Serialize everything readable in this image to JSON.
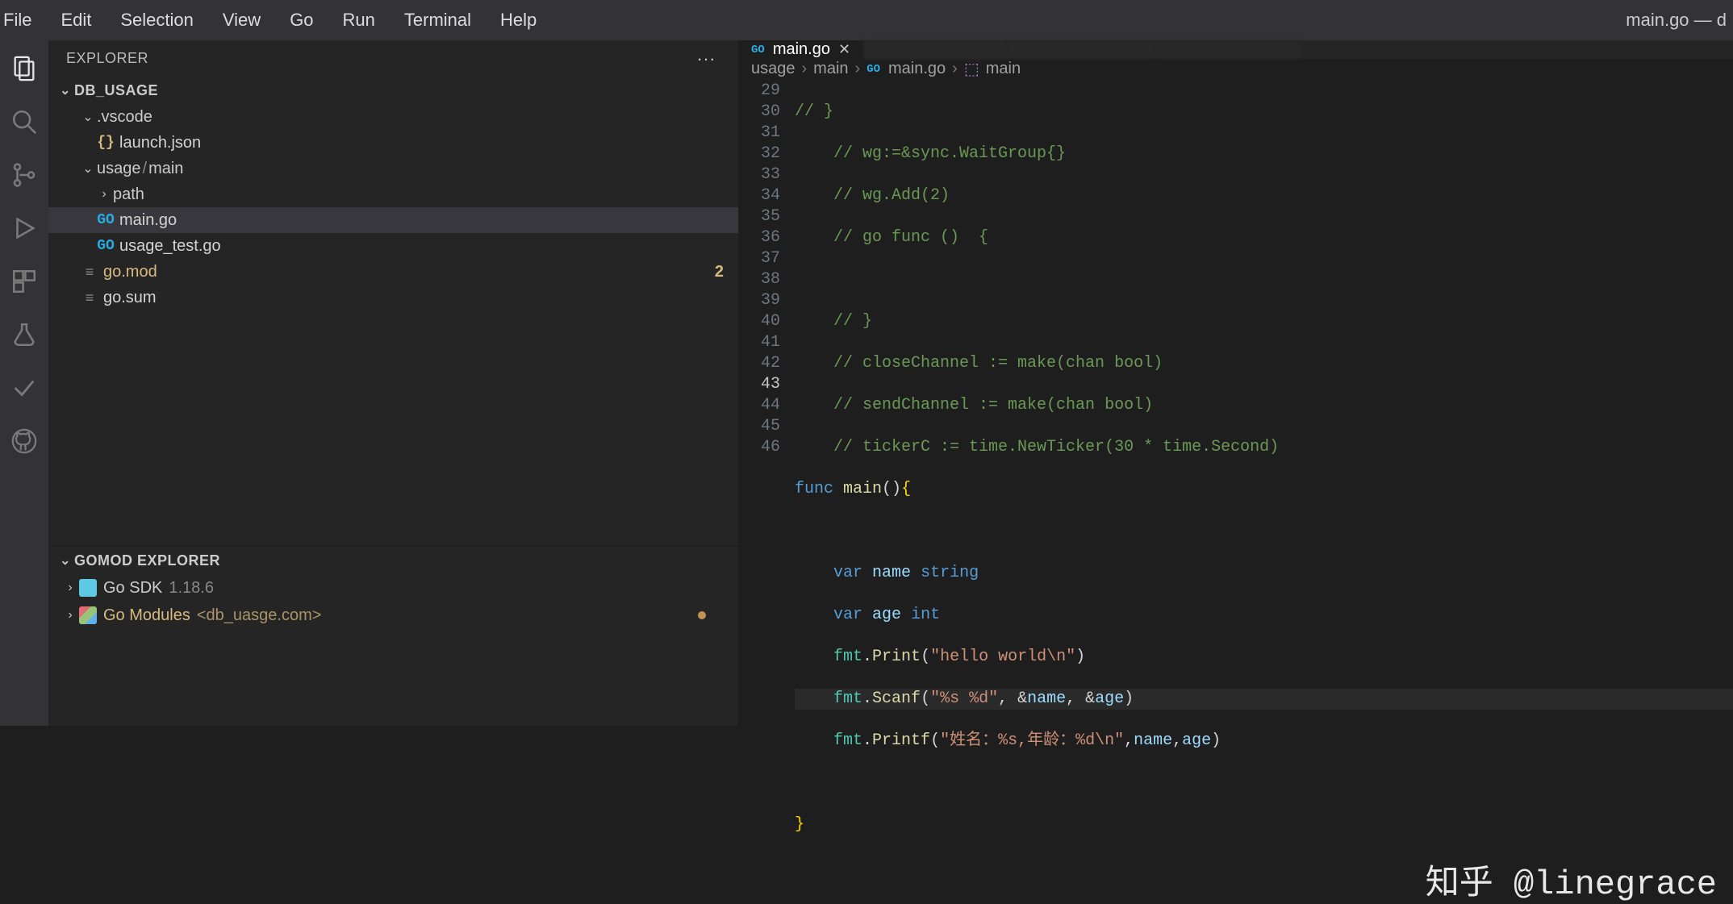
{
  "window": {
    "title": "main.go — d"
  },
  "menu": {
    "items": [
      "File",
      "Edit",
      "Selection",
      "View",
      "Go",
      "Run",
      "Terminal",
      "Help"
    ]
  },
  "sidebar": {
    "title": "EXPLORER",
    "actions_glyph": "···",
    "project_name": "DB_USAGE",
    "tree": {
      "vscode_folder": ".vscode",
      "launch_json": "launch.json",
      "usage_folder": "usage",
      "main_folder": "main",
      "path_folder": "path",
      "main_go": "main.go",
      "usage_test_go": "usage_test.go",
      "go_mod": "go.mod",
      "go_mod_badge": "2",
      "go_sum": "go.sum"
    },
    "gomod_title": "GOMOD EXPLORER",
    "gosdk_label": "Go SDK",
    "gosdk_ver": "1.18.6",
    "gomodules_label": "Go Modules",
    "gomodules_extra": "<db_uasge.com>"
  },
  "tabs": {
    "active": "main.go"
  },
  "breadcrumb": {
    "p0": "usage",
    "p1": "main",
    "p2": "main.go",
    "p3": "main"
  },
  "code": {
    "lines_start": 29,
    "l29": "// }",
    "l30": "    // wg:=&sync.WaitGroup{}",
    "l31": "    // wg.Add(2)",
    "l32": "    // go func ()  {",
    "l33": "",
    "l34": "    // }",
    "l35": "    // closeChannel := make(chan bool)",
    "l36": "    // sendChannel := make(chan bool)",
    "l37": "    // tickerC := time.NewTicker(30 * time.Second)",
    "l38_func": "func",
    "l38_main": "main",
    "l38_paren": "()",
    "l38_brace": "{",
    "l40_var": "var",
    "l40_name": "name",
    "l40_type": "string",
    "l41_var": "var",
    "l41_name": "age",
    "l41_type": "int",
    "l42_pkg": "fmt",
    "l42_fn": "Print",
    "l42_str": "\"hello world\\n\"",
    "l43_pkg": "fmt",
    "l43_fn": "Scanf",
    "l43_str": "\"%s %d\"",
    "l43_a1": "name",
    "l43_a2": "age",
    "l44_pkg": "fmt",
    "l44_fn": "Printf",
    "l44_str": "\"姓名：%s,年龄：%d\\n\"",
    "l44_a1": "name",
    "l44_a2": "age",
    "l46_brace": "}"
  },
  "watermark": "知乎 @linegrace",
  "icons": {
    "go_badge": "GO",
    "json_braces": "{}",
    "lines": "≡"
  }
}
